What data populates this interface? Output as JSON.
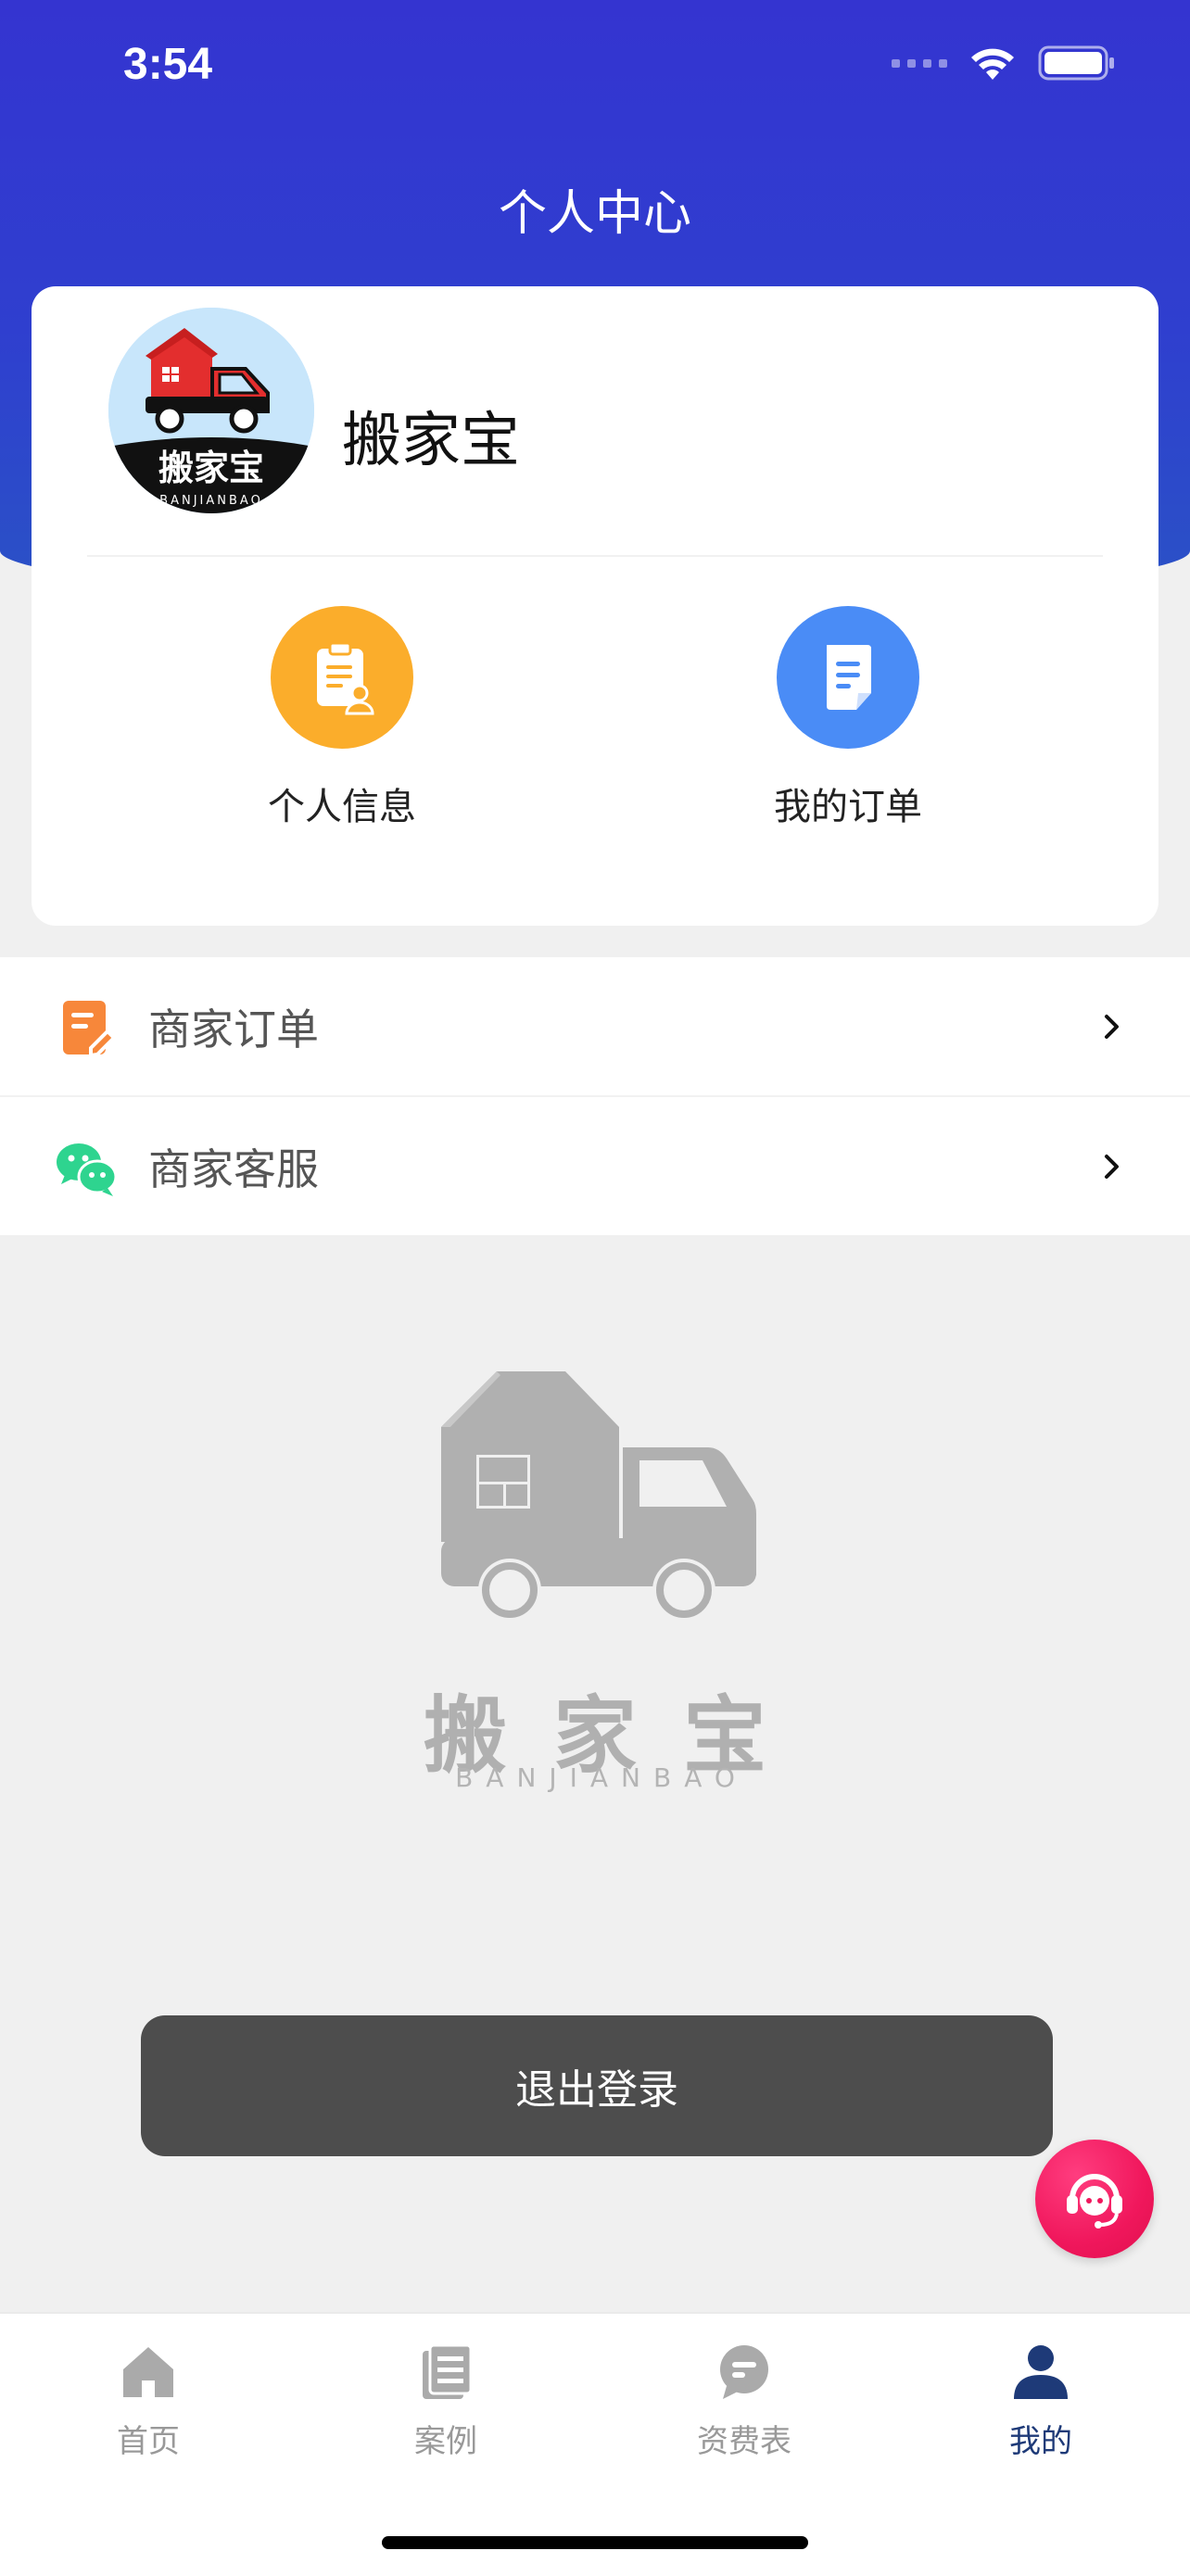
{
  "status_bar": {
    "time": "3:54"
  },
  "header": {
    "title": "个人中心"
  },
  "profile": {
    "avatar_text": "搬家宝",
    "avatar_subtext": "BANJIANBAO",
    "name": "搬家宝"
  },
  "quick_actions": [
    {
      "label": "个人信息",
      "icon": "clipboard-user-icon",
      "color": "#fbad2b"
    },
    {
      "label": "我的订单",
      "icon": "document-icon",
      "color": "#4a8cf6"
    }
  ],
  "menu": [
    {
      "label": "商家订单",
      "icon": "edit-note-icon",
      "color": "#f7873a"
    },
    {
      "label": "商家客服",
      "icon": "wechat-icon",
      "color": "#2ed48f"
    }
  ],
  "watermark": {
    "brand": "搬家宝",
    "subtitle": "BANJIANBAO"
  },
  "logout": {
    "label": "退出登录"
  },
  "support_fab": {
    "icon": "customer-service-icon",
    "color": "#f0175c"
  },
  "tabs": [
    {
      "label": "首页",
      "icon": "home-icon",
      "active": false
    },
    {
      "label": "案例",
      "icon": "list-doc-icon",
      "active": false
    },
    {
      "label": "资费表",
      "icon": "chat-bubble-icon",
      "active": false
    },
    {
      "label": "我的",
      "icon": "person-icon",
      "active": true
    }
  ],
  "colors": {
    "primary": "#3434d0",
    "tab_active": "#1e3a78",
    "tab_inactive": "#999999"
  }
}
